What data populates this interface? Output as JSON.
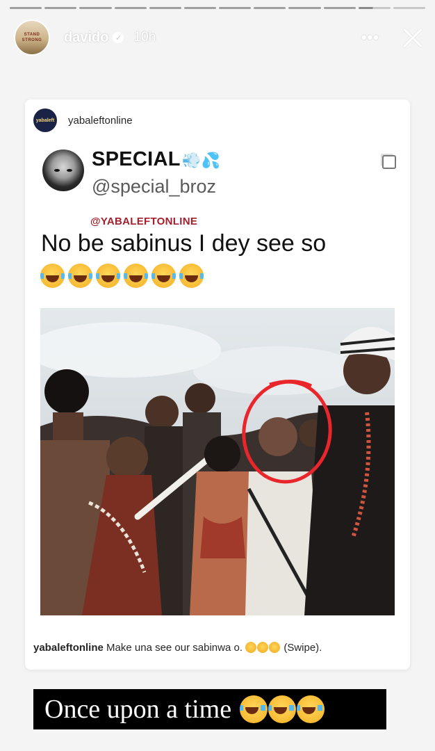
{
  "story": {
    "progress_segments": 12,
    "active_segment": 10,
    "active_progress_percent": 45,
    "username": "davido",
    "time_ago": "10h",
    "avatar_text": "STAND STRONG",
    "more_label": "•••",
    "close_icon": "close-icon"
  },
  "post": {
    "account": "yabaleftonline",
    "account_avatar_text": "yabaleft",
    "tweet": {
      "display_name": "SPECIAL",
      "name_emojis": "💨💦",
      "handle": "@special_broz",
      "watermark": "@YABALEFTONLINE",
      "text": "No be sabinus I dey see so",
      "laugh_count": 6
    },
    "caption_user": "yabaleftonline",
    "caption_text": "Make una see our sabinwa o.",
    "caption_suffix": "(Swipe)."
  },
  "sticker": {
    "text": "Once upon a time",
    "laugh_count": 3
  },
  "colors": {
    "background": "#f4f4f4",
    "card": "#ffffff",
    "watermark": "#a0212e",
    "highlight_circle": "#e8262b"
  }
}
